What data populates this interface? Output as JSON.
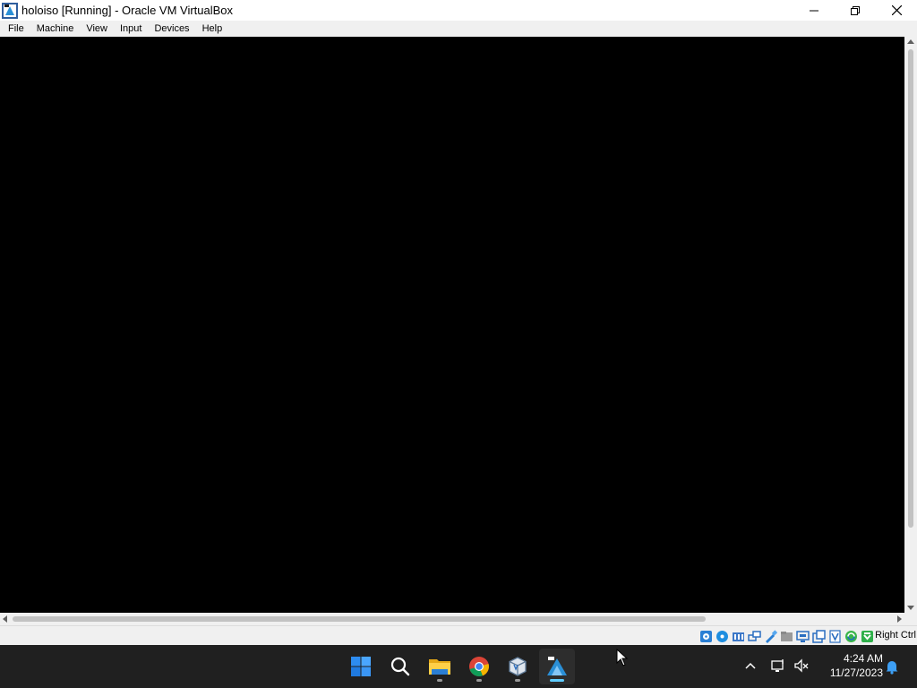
{
  "window": {
    "title": "holoiso [Running] - Oracle VM VirtualBox"
  },
  "menu": [
    "File",
    "Machine",
    "View",
    "Input",
    "Devices",
    "Help"
  ],
  "statusbar": {
    "host_key": "Right Ctrl",
    "icons": [
      "hard-disk-icon",
      "optical-drive-icon",
      "audio-icon",
      "network-icon",
      "usb-icon",
      "shared-folders-icon",
      "display-icon",
      "recording-icon",
      "vt-x-icon",
      "guest-additions-icon",
      "mouse-integration-icon"
    ]
  },
  "taskbar": {
    "apps": [
      "start-icon",
      "search-icon",
      "file-explorer-icon",
      "chrome-icon",
      "virtualbox-icon",
      "holoiso-vm-icon"
    ],
    "clock_time": "4:24 AM",
    "clock_date": "11/27/2023"
  },
  "colors": {
    "vm_background": "#000000",
    "taskbar": "#202020",
    "accent": "#60cdff"
  }
}
